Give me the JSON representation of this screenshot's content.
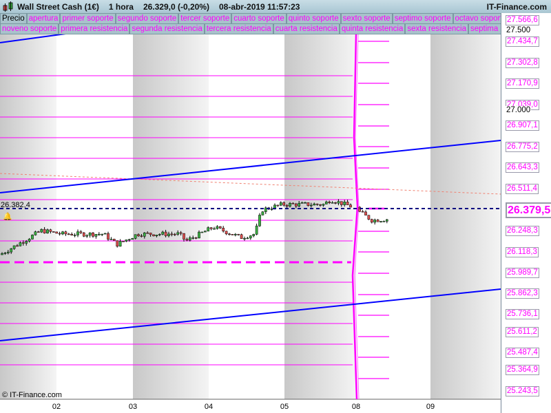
{
  "header": {
    "instrument": "Wall Street Cash (1€)",
    "timeframe": "1 hora",
    "quote": "26.329,0 (-0,20%)",
    "datetime": "08-abr-2019 11:57:23",
    "brand": "IT-Finance.com"
  },
  "legend_row1": [
    "Precio",
    "apertura",
    "primer soporte",
    "segundo soporte",
    "tercer soporte",
    "cuarto soporte",
    "quinto soporte",
    "sexto soporte",
    "septimo soporte",
    "octavo soporte"
  ],
  "legend_row2": [
    "noveno soporte",
    "primera resistencia",
    "segunda resistencia",
    "tercera resistencia",
    "cuarta resistencia",
    "quinta resistencia",
    "sexta resistencia",
    "septima resistencia"
  ],
  "last_price_left": "26.382,4",
  "footer": "© IT-Finance.com",
  "colors": {
    "level": "#ff00ff",
    "trend": "#0000ff",
    "price_line": "#000080",
    "candle_up": "#3cb043",
    "candle_down": "#e05050"
  },
  "chart_data": {
    "type": "candlestick",
    "y_ticks": [
      "27.566,6",
      "27.500",
      "27.434,7",
      "27.302,8",
      "27.170,9",
      "27.039,0",
      "27.000",
      "26.907,1",
      "26.775,2",
      "26.643,3",
      "26.511,4",
      "26.379,5",
      "26.248,3",
      "26.118,3",
      "25.989,7",
      "25.862,3",
      "25.736,1",
      "25.611,2",
      "25.487,4",
      "25.364,9",
      "25.243,5"
    ],
    "current_price": "26.379,5",
    "x_ticks": [
      "02",
      "03",
      "04",
      "05",
      "08",
      "09"
    ],
    "close_keypoints": [
      26099,
      26250,
      26229,
      26229,
      26164,
      26229,
      26229,
      26185,
      26272,
      26207,
      26229,
      26379,
      26414,
      26414,
      26444,
      26401,
      26315,
      26323
    ]
  }
}
